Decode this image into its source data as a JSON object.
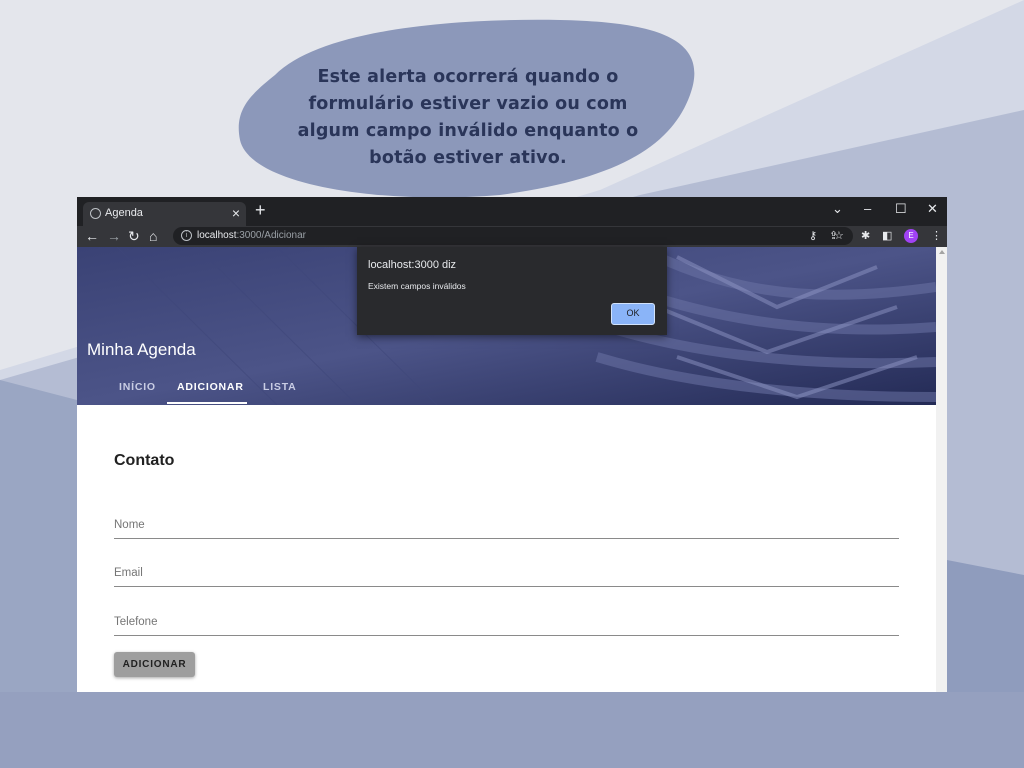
{
  "slide": {
    "callout_text": "Este alerta ocorrerá quando o formulário estiver vazio ou com algum campo inválido enquanto o botão estiver ativo."
  },
  "browser": {
    "tab_title": "Agenda",
    "address_host": "localhost",
    "address_path": ":3000/Adicionar",
    "avatar_letter": "E"
  },
  "app": {
    "title": "Minha Agenda",
    "nav": [
      {
        "label": "INÍCIO"
      },
      {
        "label": "ADICIONAR"
      },
      {
        "label": "LISTA"
      }
    ],
    "active_nav": "ADICIONAR"
  },
  "form": {
    "title": "Contato",
    "fields": [
      {
        "label": "Nome",
        "value": ""
      },
      {
        "label": "Email",
        "value": ""
      },
      {
        "label": "Telefone",
        "value": ""
      }
    ],
    "submit_label": "ADICIONAR"
  },
  "alert": {
    "title": "localhost:3000 diz",
    "message": "Existem campos inválidos",
    "ok_label": "OK"
  },
  "colors": {
    "blob": "#8c98ba",
    "callout_text": "#2a3559",
    "hero": "#2d3568",
    "ok_button": "#8ab4f8",
    "avatar": "#a142f4"
  }
}
